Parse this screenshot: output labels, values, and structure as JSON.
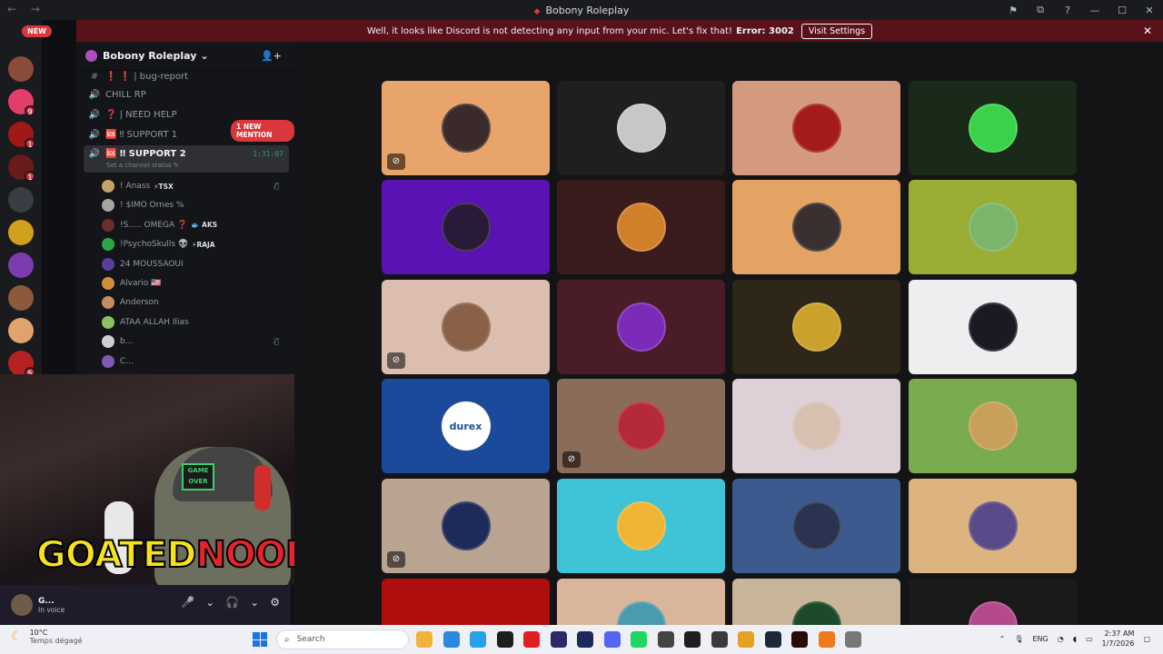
{
  "window": {
    "title": "Bobony Roleplay",
    "nav": "← →",
    "controls": [
      "⚑",
      "⧉",
      "?",
      "—",
      "☐",
      "✕"
    ]
  },
  "banner": {
    "message": "Well, it looks like Discord is not detecting any input from your mic. Let's fix that!",
    "error": "Error: 3002",
    "button": "Visit Settings",
    "close": "✕"
  },
  "rail": {
    "new_label": "NEW",
    "servers": [
      {
        "color": "#8a4b3a",
        "badge": ""
      },
      {
        "color": "#e23d6b",
        "badge": "9"
      },
      {
        "color": "#a11818",
        "badge": "1"
      },
      {
        "color": "#6b1b1b",
        "badge": "1"
      },
      {
        "color": "#3a3c44",
        "badge": ""
      },
      {
        "color": "#d1a01c",
        "badge": ""
      },
      {
        "color": "#7d3bb0",
        "badge": ""
      },
      {
        "color": "#8c5a3a",
        "badge": ""
      },
      {
        "color": "#e0a36e",
        "badge": ""
      },
      {
        "color": "#b52222",
        "badge": "5"
      }
    ]
  },
  "guild": {
    "name": "Bobony Roleplay",
    "chevron": "⌄",
    "invite_icon": "👤+"
  },
  "channels": [
    {
      "icon": "#",
      "label": "❗ ❗ | bug-report",
      "active": false
    },
    {
      "icon": "🔊",
      "label": "CHILL RP",
      "active": false
    },
    {
      "icon": "🔊",
      "label": "❓ | NEED HELP",
      "active": false
    },
    {
      "icon": "🔊",
      "label": "🆘 ‼ SUPPORT 1",
      "active": false
    },
    {
      "icon": "🔊",
      "label": "🆘 ‼ SUPPORT 2",
      "active": true,
      "time": "1:31:07",
      "status": "Set a channel status ✎"
    }
  ],
  "mention": "1 NEW MENTION",
  "voice_users": [
    {
      "name": "! Anass",
      "tag": "⚡TSX",
      "color": "#c7a36a",
      "muted": true
    },
    {
      "name": "! $IMO Ornes %",
      "tag": "",
      "color": "#a5a5a5",
      "muted": false
    },
    {
      "name": "!S..... OMEGA ❓",
      "tag": "🐟 AKS",
      "color": "#6b2d2d",
      "muted": false
    },
    {
      "name": "!PsychoSkulls 👽",
      "tag": "⚡RAJA",
      "color": "#2aa74a",
      "muted": false
    },
    {
      "name": "24 MOUSSAOUI",
      "tag": "",
      "color": "#5b3d9a",
      "muted": false
    },
    {
      "name": "Alvario 🇺🇸",
      "tag": "",
      "color": "#d08f3a",
      "muted": false
    },
    {
      "name": "Anderson",
      "tag": "",
      "color": "#c08d60",
      "muted": false
    },
    {
      "name": "ATAA ALLAH Ilias",
      "tag": "",
      "color": "#8dbf63",
      "muted": false
    },
    {
      "name": "b...",
      "tag": "",
      "color": "#cfcfcf",
      "muted": true
    },
    {
      "name": "C...",
      "tag": "",
      "color": "#7d5ab0",
      "muted": false
    }
  ],
  "webcam": {
    "cap_text": "GAME OVER",
    "logo_part1": "GOATED",
    "logo_part2": "NOOBIE"
  },
  "user_panel": {
    "name": "G...",
    "status": "In voice",
    "tools": [
      "🎤",
      "⌄",
      "🎧",
      "⌄",
      "⚙"
    ]
  },
  "tiles": [
    {
      "bg": "#e8a46a",
      "avatar": "#3b2a2a",
      "muted": true
    },
    {
      "bg": "#1f1f1f",
      "avatar": "#c7c7c7",
      "muted": false
    },
    {
      "bg": "#d49a80",
      "avatar": "#a51b1b",
      "muted": false
    },
    {
      "bg": "#1a2a18",
      "avatar": "#3bd14a",
      "muted": false
    },
    {
      "bg": "#5b12b5",
      "avatar": "#2a1a3a",
      "muted": false
    },
    {
      "bg": "#3a1c1c",
      "avatar": "#d1802a",
      "muted": false
    },
    {
      "bg": "#e4a363",
      "avatar": "#3a3030",
      "muted": false
    },
    {
      "bg": "#9aad34",
      "avatar": "#7bb56a",
      "muted": false
    },
    {
      "bg": "#dcbeb1",
      "avatar": "#8a6048",
      "muted": true
    },
    {
      "bg": "#4a1c28",
      "avatar": "#7b2bb8",
      "muted": false
    },
    {
      "bg": "#2e2618",
      "avatar": "#caa12a",
      "muted": false
    },
    {
      "bg": "#eceef0",
      "avatar": "#1a1a22",
      "muted": false
    },
    {
      "bg": "#1c4a9a",
      "avatar": "#ffffff",
      "muted": false,
      "durex": "durex"
    },
    {
      "bg": "#8a6c5b",
      "avatar": "#b52a3a",
      "muted": true
    },
    {
      "bg": "#ddd0d6",
      "avatar": "#d8c0b0",
      "muted": false
    },
    {
      "bg": "#7bab4f",
      "avatar": "#c8a05a",
      "muted": false
    },
    {
      "bg": "#b9a391",
      "avatar": "#1e2a5a",
      "muted": true
    },
    {
      "bg": "#3fc4d7",
      "avatar": "#f0b534",
      "muted": false
    },
    {
      "bg": "#3c5a8e",
      "avatar": "#2a3450",
      "muted": false
    },
    {
      "bg": "#ddb380",
      "avatar": "#5a4a8a",
      "muted": false
    },
    {
      "bg": "#b00e0e",
      "avatar": "",
      "muted": false
    },
    {
      "bg": "#d9b59c",
      "avatar": "#4a9ab0",
      "muted": false
    },
    {
      "bg": "#c8b59a",
      "avatar": "#1d4a2a",
      "muted": false
    },
    {
      "bg": "#1a1a1a",
      "avatar": "#b44a8a",
      "muted": false
    }
  ],
  "taskbar": {
    "temp": "10°C",
    "weather": "Temps dégagé",
    "search_placeholder": "Search",
    "lang": "ENG",
    "time": "2:37 AM",
    "date": "1/7/2026",
    "apps": [
      "#f2b23a",
      "#2a8ae0",
      "#2aa0e8",
      "#1e1e1e",
      "#e02020",
      "#2a2a6a",
      "#1b2a5a",
      "#5865f2",
      "#1ed760",
      "#444",
      "#1e1e1e",
      "#3a3a3a",
      "#e8a020",
      "#1b2838",
      "#2a0a0a",
      "#f07a1a",
      "#777"
    ]
  }
}
